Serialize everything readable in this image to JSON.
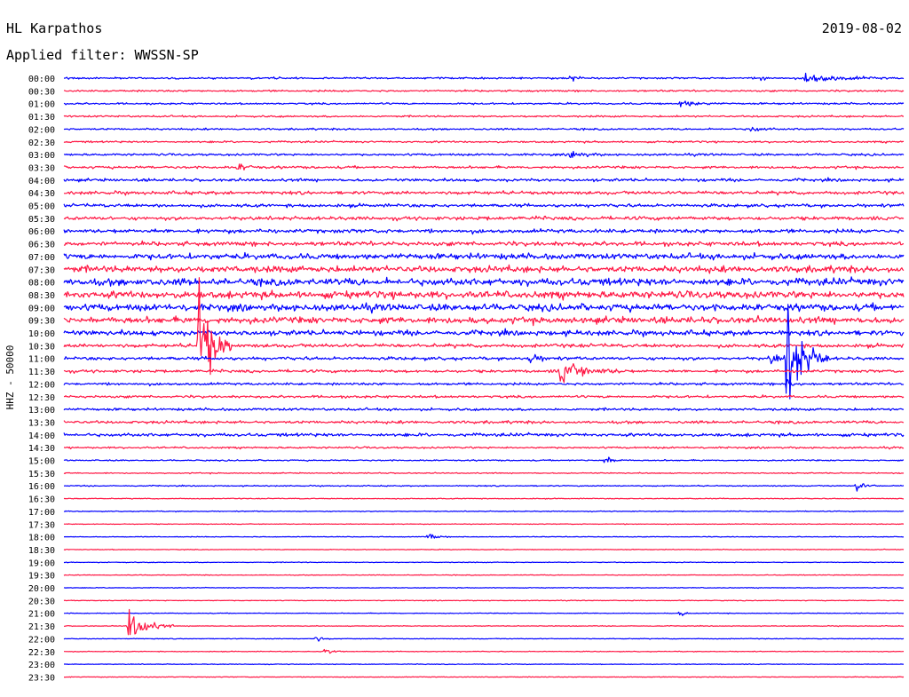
{
  "header": {
    "station": "HL Karpathos",
    "date": "2019-08-02",
    "filter_text": "Applied filter: WWSSN-SP"
  },
  "chart_data": {
    "type": "line",
    "ylabel": "HHZ - 50000",
    "rows": [
      "00:00",
      "00:30",
      "01:00",
      "01:30",
      "02:00",
      "02:30",
      "03:00",
      "03:30",
      "04:00",
      "04:30",
      "05:00",
      "05:30",
      "06:00",
      "06:30",
      "07:00",
      "07:30",
      "08:00",
      "08:30",
      "09:00",
      "09:30",
      "10:00",
      "10:30",
      "11:00",
      "11:30",
      "12:00",
      "12:30",
      "13:00",
      "13:30",
      "14:00",
      "14:30",
      "15:00",
      "15:30",
      "16:00",
      "16:30",
      "17:00",
      "17:30",
      "18:00",
      "18:30",
      "19:00",
      "19:30",
      "20:00",
      "20:30",
      "21:00",
      "21:30",
      "22:00",
      "22:30",
      "23:00",
      "23:30"
    ],
    "x_range": [
      0,
      30
    ],
    "series_colors": [
      "#0000ff",
      "#ff1744"
    ],
    "noise_amplitude": [
      0.25,
      0.25,
      0.25,
      0.25,
      0.25,
      0.25,
      0.3,
      0.35,
      0.4,
      0.45,
      0.45,
      0.5,
      0.55,
      0.6,
      0.8,
      0.9,
      1.0,
      1.0,
      0.95,
      0.9,
      0.7,
      0.5,
      0.45,
      0.4,
      0.35,
      0.35,
      0.35,
      0.4,
      0.45,
      0.25,
      0.18,
      0.15,
      0.15,
      0.12,
      0.12,
      0.1,
      0.1,
      0.1,
      0.1,
      0.1,
      0.1,
      0.1,
      0.1,
      0.1,
      0.1,
      0.1,
      0.1,
      0.1
    ],
    "events": [
      {
        "row": 0,
        "minute": 18.1,
        "amplitude": 3,
        "duration": 0.4
      },
      {
        "row": 0,
        "minute": 26.5,
        "amplitude": 1.4,
        "duration": 3
      },
      {
        "row": 0,
        "minute": 24.9,
        "amplitude": 1.0,
        "duration": 0.5
      },
      {
        "row": 2,
        "minute": 22.0,
        "amplitude": 1.0,
        "duration": 1.5
      },
      {
        "row": 4,
        "minute": 24.5,
        "amplitude": 1.0,
        "duration": 1.0
      },
      {
        "row": 6,
        "minute": 18.1,
        "amplitude": 1.2,
        "duration": 1.2
      },
      {
        "row": 7,
        "minute": 6.2,
        "amplitude": 1.0,
        "duration": 1.0
      },
      {
        "row": 21,
        "minute": 4.8,
        "amplitude": 18,
        "duration": 1.2
      },
      {
        "row": 22,
        "minute": 25.8,
        "amplitude": 15,
        "duration": 1.5
      },
      {
        "row": 22,
        "minute": 25.2,
        "amplitude": 1.2,
        "duration": 2.0
      },
      {
        "row": 22,
        "minute": 16.6,
        "amplitude": 1.5,
        "duration": 1.0
      },
      {
        "row": 23,
        "minute": 17.7,
        "amplitude": 3.0,
        "duration": 2.5
      },
      {
        "row": 24,
        "minute": 25.8,
        "amplitude": 1.2,
        "duration": 0.7
      },
      {
        "row": 30,
        "minute": 19.3,
        "amplitude": 1.5,
        "duration": 0.8
      },
      {
        "row": 32,
        "minute": 28.3,
        "amplitude": 1.8,
        "duration": 0.7
      },
      {
        "row": 36,
        "minute": 13.0,
        "amplitude": 1.2,
        "duration": 0.7
      },
      {
        "row": 42,
        "minute": 22.0,
        "amplitude": 1.0,
        "duration": 0.5
      },
      {
        "row": 43,
        "minute": 2.3,
        "amplitude": 5.0,
        "duration": 1.6
      },
      {
        "row": 44,
        "minute": 9.0,
        "amplitude": 1.0,
        "duration": 0.6
      },
      {
        "row": 45,
        "minute": 9.3,
        "amplitude": 1.5,
        "duration": 0.7
      }
    ]
  }
}
